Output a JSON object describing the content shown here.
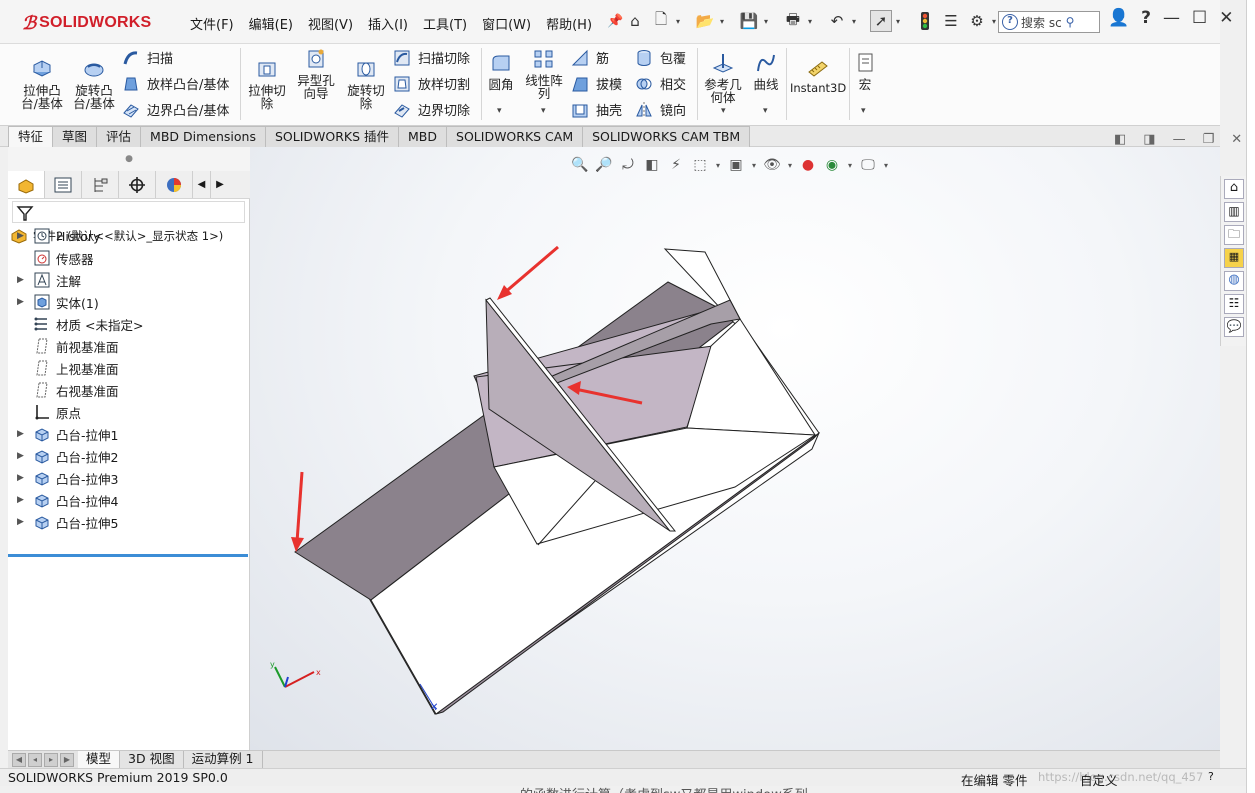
{
  "app": {
    "logo_text": "SOLIDWORKS",
    "menus": [
      "文件(F)",
      "编辑(E)",
      "视图(V)",
      "插入(I)",
      "工具(T)",
      "窗口(W)",
      "帮助(H)"
    ],
    "search_placeholder": "搜索 sc",
    "help_label": "?"
  },
  "ribbon": {
    "extrude_boss": "拉伸凸\n台/基体",
    "revolve_boss": "旋转凸\n台/基体",
    "sweep": "扫描",
    "loft_boss": "放样凸台/基体",
    "boundary_boss": "边界凸台/基体",
    "extrude_cut": "拉伸切\n除",
    "hole_wizard": "异型孔\n向导",
    "revolve_cut": "旋转切\n除",
    "swept_cut": "扫描切除",
    "lofted_cut": "放样切割",
    "boundary_cut": "边界切除",
    "fillet": "圆角",
    "linear_pattern": "线性阵\n列",
    "rib": "筋",
    "draft": "拔模",
    "shell": "抽壳",
    "wrap": "包覆",
    "intersect": "相交",
    "mirror": "镜向",
    "ref_geometry": "参考几\n何体",
    "curves": "曲线",
    "instant3d": "Instant3D",
    "macro": "宏"
  },
  "command_tabs": [
    "特征",
    "草图",
    "评估",
    "MBD Dimensions",
    "SOLIDWORKS 插件",
    "MBD",
    "SOLIDWORKS CAM",
    "SOLIDWORKS CAM TBM"
  ],
  "feature_tree": {
    "root": "零件2  (默认<<默认>_显示状态 1>)",
    "items": [
      {
        "label": "History",
        "expandable": true,
        "icon": "history-icon"
      },
      {
        "label": "传感器",
        "expandable": false,
        "icon": "sensor-icon"
      },
      {
        "label": "注解",
        "expandable": true,
        "icon": "annotation-icon"
      },
      {
        "label": "实体(1)",
        "expandable": true,
        "icon": "solid-bodies-icon"
      },
      {
        "label": "材质 <未指定>",
        "expandable": false,
        "icon": "material-icon"
      },
      {
        "label": "前视基准面",
        "expandable": false,
        "icon": "plane-icon"
      },
      {
        "label": "上视基准面",
        "expandable": false,
        "icon": "plane-icon"
      },
      {
        "label": "右视基准面",
        "expandable": false,
        "icon": "plane-icon"
      },
      {
        "label": "原点",
        "expandable": false,
        "icon": "origin-icon"
      },
      {
        "label": "凸台-拉伸1",
        "expandable": true,
        "icon": "extrude-icon"
      },
      {
        "label": "凸台-拉伸2",
        "expandable": true,
        "icon": "extrude-icon"
      },
      {
        "label": "凸台-拉伸3",
        "expandable": true,
        "icon": "extrude-icon"
      },
      {
        "label": "凸台-拉伸4",
        "expandable": true,
        "icon": "extrude-icon"
      },
      {
        "label": "凸台-拉伸5",
        "expandable": true,
        "icon": "extrude-icon"
      }
    ]
  },
  "bottom_tabs": [
    "模型",
    "3D 视图",
    "运动算例 1"
  ],
  "status": {
    "version": "SOLIDWORKS Premium 2019 SP0.0",
    "mode": "在编辑 零件",
    "custom": "自定义",
    "watermark": "https://blog.csdn.net/qq_457"
  },
  "background_text": "的函数进行计算（考虑到sw又都是用window系列",
  "colors": {
    "brand_red": "#d11f2a",
    "annotation_arrow": "#e8322e",
    "shaded_face": "#8b828c",
    "light_face": "#c3b6c5",
    "tree_accent": "#3c8dd6"
  }
}
